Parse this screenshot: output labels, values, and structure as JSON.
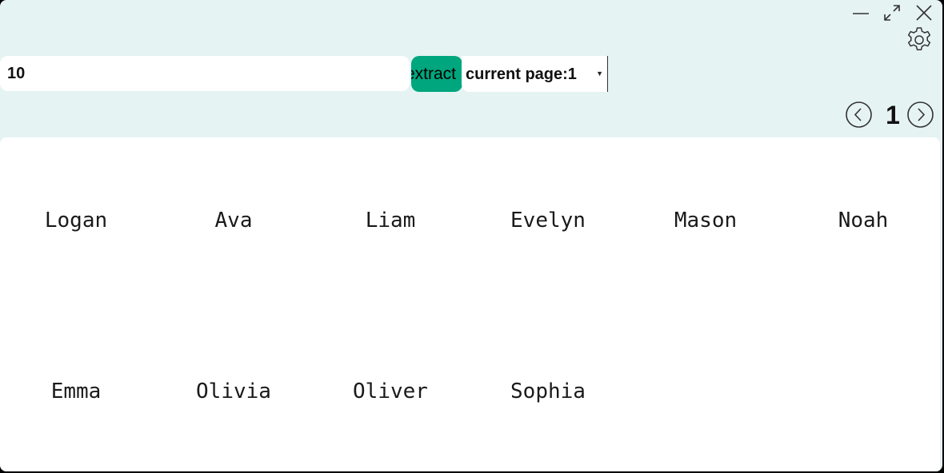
{
  "window": {
    "colors": {
      "background": "#e6f3f3",
      "accent": "#00a67e",
      "panel": "#ffffff"
    },
    "controls": {
      "minimize_icon": "minimize-icon",
      "maximize_icon": "maximize-icon",
      "close_icon": "close-icon",
      "settings_icon": "gear-icon"
    }
  },
  "toolbar": {
    "count_value": "10",
    "extract_label": "extract",
    "page_select_value": "current page:1"
  },
  "pager": {
    "prev_icon": "chevron-left-circle-icon",
    "next_icon": "chevron-right-circle-icon",
    "current_page": "1"
  },
  "names": [
    [
      "Logan",
      "Ava",
      "Liam",
      "Evelyn",
      "Mason",
      "Noah"
    ],
    [
      "Emma",
      "Olivia",
      "Oliver",
      "Sophia"
    ]
  ]
}
